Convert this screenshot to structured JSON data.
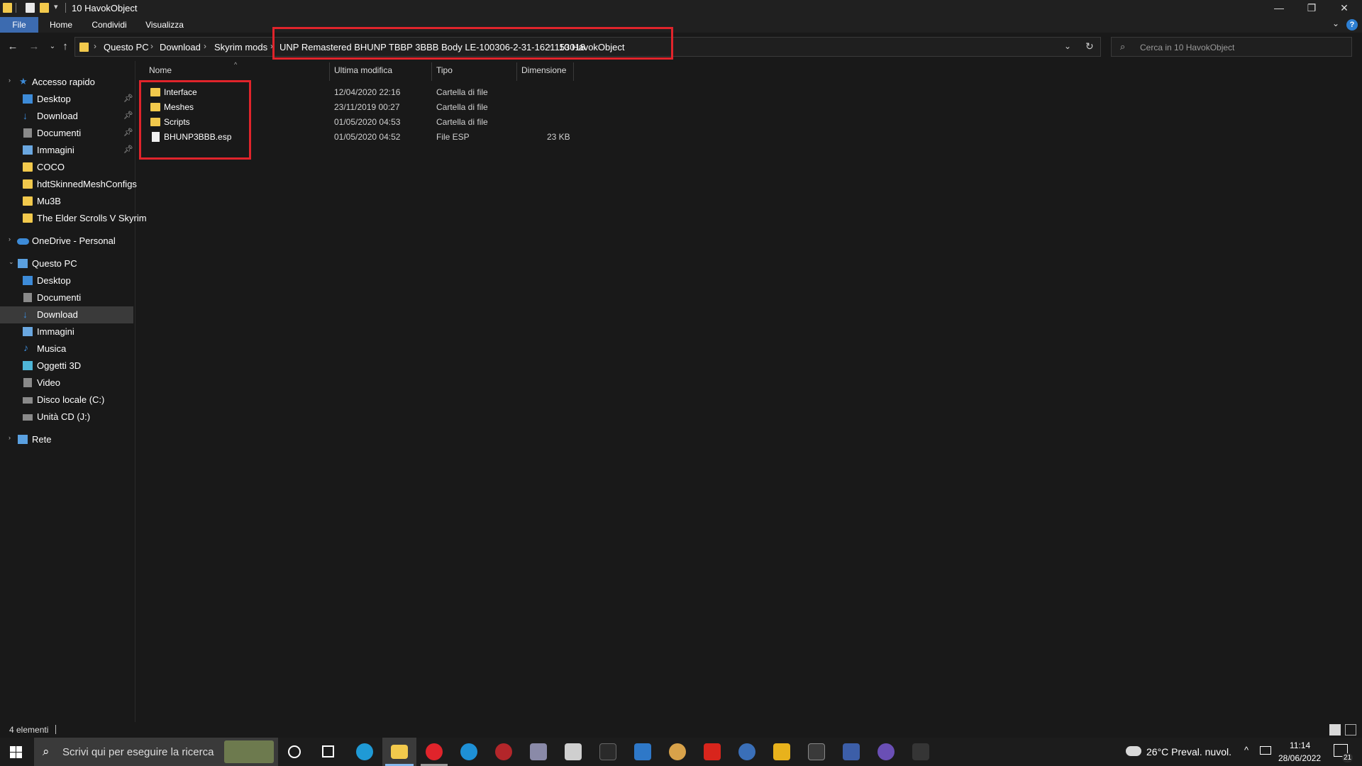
{
  "window": {
    "title": "10 HavokObject",
    "minimize_glyph": "—",
    "restore_glyph": "❐",
    "close_glyph": "✕"
  },
  "ribbon": {
    "tabs": [
      "File",
      "Home",
      "Condividi",
      "Visualizza"
    ],
    "help_glyph": "?"
  },
  "address": {
    "crumbs": [
      "Questo PC",
      "Download",
      "Skyrim mods",
      "UNP Remastered BHUNP TBBP 3BBB Body LE-100306-2-31-1621153018",
      "10 HavokObject"
    ],
    "separator": "›"
  },
  "search": {
    "placeholder": "Cerca in 10 HavokObject"
  },
  "nav_pane": {
    "quick_access": "Accesso rapido",
    "quick_items": [
      {
        "label": "Desktop",
        "icon": "desktop-icon",
        "pinned": true
      },
      {
        "label": "Download",
        "icon": "download-icon",
        "pinned": true
      },
      {
        "label": "Documenti",
        "icon": "documents-icon",
        "pinned": true
      },
      {
        "label": "Immagini",
        "icon": "pictures-icon",
        "pinned": true
      },
      {
        "label": "COCO",
        "icon": "folder-icon",
        "pinned": false
      },
      {
        "label": "hdtSkinnedMeshConfigs",
        "icon": "folder-icon",
        "pinned": false
      },
      {
        "label": "Mu3B",
        "icon": "folder-icon",
        "pinned": false
      },
      {
        "label": "The Elder Scrolls V Skyrim",
        "icon": "folder-icon",
        "pinned": false
      }
    ],
    "onedrive": "OneDrive - Personal",
    "this_pc": "Questo PC",
    "pc_items": [
      {
        "label": "Desktop",
        "icon": "desktop-icon"
      },
      {
        "label": "Documenti",
        "icon": "documents-icon"
      },
      {
        "label": "Download",
        "icon": "download-icon",
        "selected": true
      },
      {
        "label": "Immagini",
        "icon": "pictures-icon"
      },
      {
        "label": "Musica",
        "icon": "music-icon"
      },
      {
        "label": "Oggetti 3D",
        "icon": "3d-objects-icon"
      },
      {
        "label": "Video",
        "icon": "video-icon"
      },
      {
        "label": "Disco locale (C:)",
        "icon": "drive-icon"
      },
      {
        "label": "Unità CD (J:)",
        "icon": "cd-drive-icon"
      }
    ],
    "network": "Rete"
  },
  "columns": {
    "name": "Nome",
    "modified": "Ultima modifica",
    "type": "Tipo",
    "size": "Dimensione"
  },
  "files": [
    {
      "name": "Interface",
      "modified": "12/04/2020 22:16",
      "type": "Cartella di file",
      "size": "",
      "icon": "folder-icon"
    },
    {
      "name": "Meshes",
      "modified": "23/11/2019 00:27",
      "type": "Cartella di file",
      "size": "",
      "icon": "folder-icon"
    },
    {
      "name": "Scripts",
      "modified": "01/05/2020 04:53",
      "type": "Cartella di file",
      "size": "",
      "icon": "folder-icon"
    },
    {
      "name": "BHUNP3BBB.esp",
      "modified": "01/05/2020 04:52",
      "type": "File ESP",
      "size": "23 KB",
      "icon": "file-icon"
    }
  ],
  "status": {
    "count": "4 elementi"
  },
  "taskbar": {
    "search_placeholder": "Scrivi qui per eseguire la ricerca",
    "weather": "26°C  Preval. nuvol.",
    "time": "11:14",
    "date": "28/06/2022",
    "notification_count": "21",
    "app_colors": {
      "edge": "#1f9ad6",
      "opera": "#e0242b",
      "skype": "#1e90d6",
      "explorer": "#f2c94c",
      "accent": "#86b8ec"
    }
  }
}
